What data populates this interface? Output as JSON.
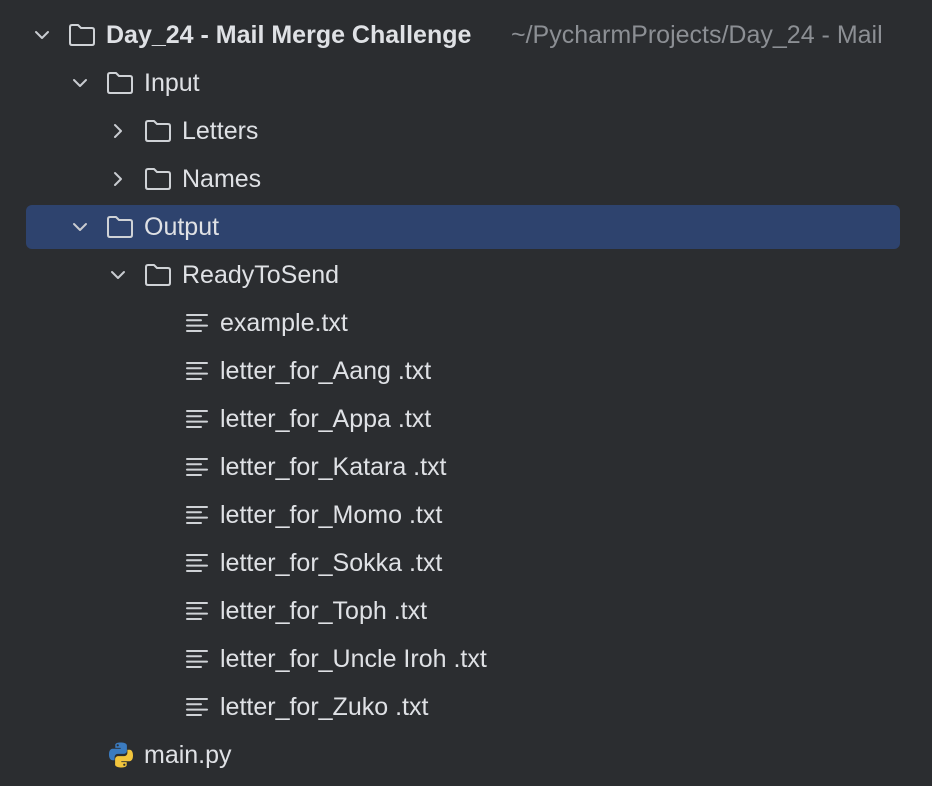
{
  "project_tree": {
    "root": {
      "name": "Day_24 - Mail Merge Challenge",
      "path": "~/PycharmProjects/Day_24 - Mail",
      "expanded": true
    },
    "nodes": [
      {
        "name": "Input",
        "type": "folder",
        "expanded": true,
        "depth": 1
      },
      {
        "name": "Letters",
        "type": "folder",
        "expanded": false,
        "depth": 2
      },
      {
        "name": "Names",
        "type": "folder",
        "expanded": false,
        "depth": 2
      },
      {
        "name": "Output",
        "type": "folder",
        "expanded": true,
        "depth": 1,
        "selected": true
      },
      {
        "name": "ReadyToSend",
        "type": "folder",
        "expanded": true,
        "depth": 2
      },
      {
        "name": "example.txt",
        "type": "text-file",
        "depth": 3
      },
      {
        "name": "letter_for_Aang .txt",
        "type": "text-file",
        "depth": 3
      },
      {
        "name": "letter_for_Appa .txt",
        "type": "text-file",
        "depth": 3
      },
      {
        "name": "letter_for_Katara .txt",
        "type": "text-file",
        "depth": 3
      },
      {
        "name": "letter_for_Momo .txt",
        "type": "text-file",
        "depth": 3
      },
      {
        "name": "letter_for_Sokka .txt",
        "type": "text-file",
        "depth": 3
      },
      {
        "name": "letter_for_Toph .txt",
        "type": "text-file",
        "depth": 3
      },
      {
        "name": "letter_for_Uncle Iroh .txt",
        "type": "text-file",
        "depth": 3
      },
      {
        "name": "letter_for_Zuko .txt",
        "type": "text-file",
        "depth": 3
      },
      {
        "name": "main.py",
        "type": "python-file",
        "depth": 1
      }
    ]
  },
  "colors": {
    "background": "#2b2d30",
    "selection": "#2e436e",
    "text": "#dfe1e5",
    "muted": "#8c8f94",
    "python_blue": "#3b7bbf",
    "python_yellow": "#f2c53d"
  }
}
